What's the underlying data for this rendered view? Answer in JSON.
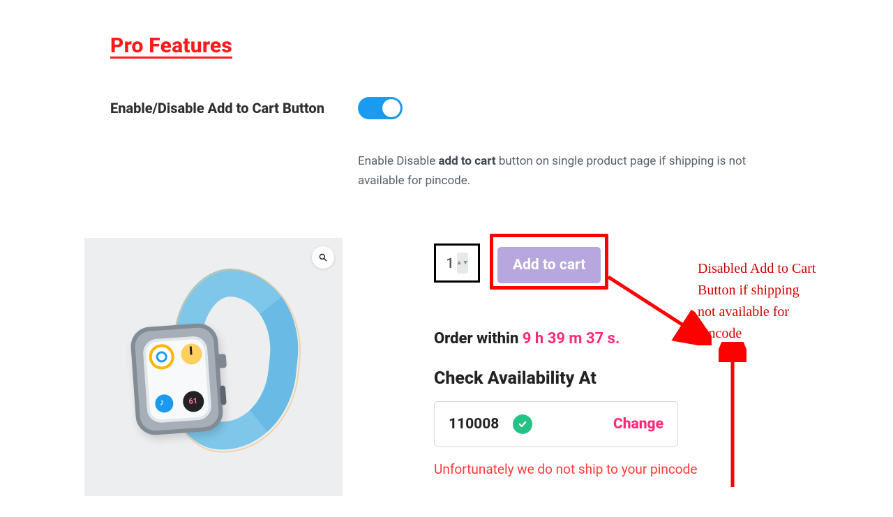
{
  "section_title": "Pro Features",
  "setting": {
    "label": "Enable/Disable Add to Cart Button",
    "desc_prefix": "Enable Disable ",
    "desc_bold": "add to cart",
    "desc_suffix": " button on single product page if shipping is not available for pincode.",
    "toggle_on": true
  },
  "product": {
    "quantity": "1",
    "add_to_cart_label": "Add to cart",
    "order_prefix": "Order within ",
    "countdown": "9 h 39 m 37 s.",
    "availability_heading": "Check Availability At",
    "pincode": "110008",
    "change_label": "Change",
    "error_text": "Unfortunately we do not ship to your pincode"
  },
  "annotation": "Disabled Add to Cart Button if shipping not available for pincode"
}
